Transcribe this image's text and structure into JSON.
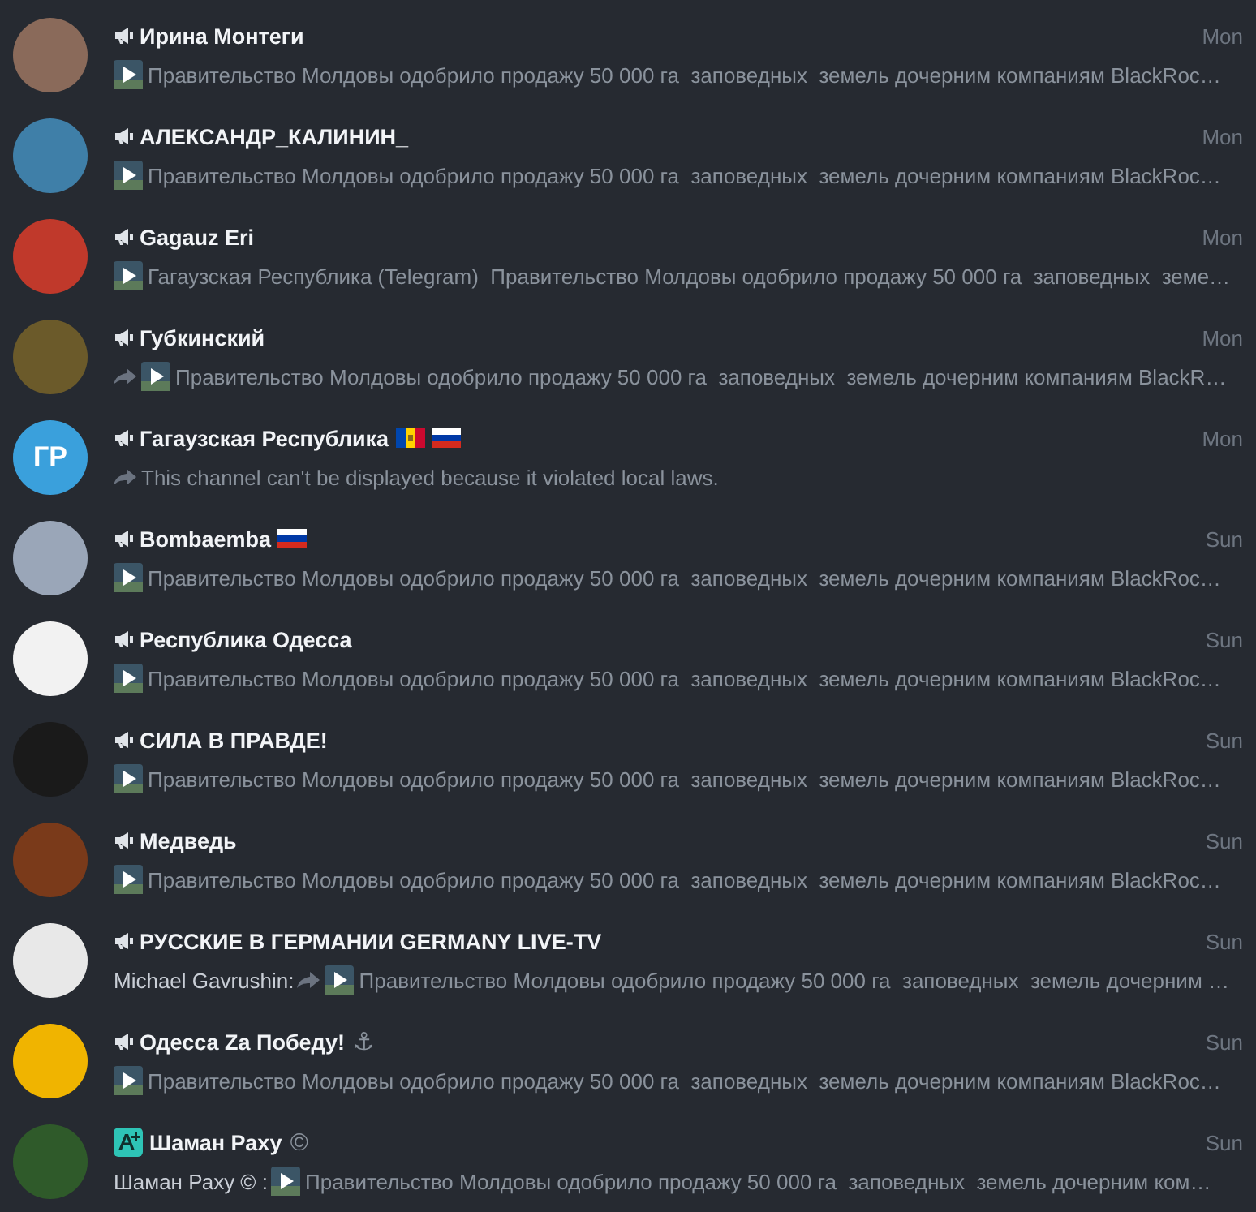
{
  "chats": [
    {
      "kind": "channel",
      "name": "Ирина Монтеги",
      "date": "Mon",
      "avatar": {
        "kind": "photo",
        "color": "#8a6a5a"
      },
      "forwarded": false,
      "video": true,
      "preview": "Правительство Молдовы одобрило продажу 50 000 га  заповедных  земель дочерним компаниям BlackRoc…"
    },
    {
      "kind": "channel",
      "name": "АЛЕКСАНДР_КАЛИНИН_",
      "date": "Mon",
      "avatar": {
        "kind": "photo",
        "color": "#3f7fa8"
      },
      "forwarded": false,
      "video": true,
      "preview": "Правительство Молдовы одобрило продажу 50 000 га  заповедных  земель дочерним компаниям BlackRoc…"
    },
    {
      "kind": "channel",
      "name": "Gagauz Eri",
      "date": "Mon",
      "avatar": {
        "kind": "photo",
        "color": "#c0392b"
      },
      "forwarded": false,
      "video": true,
      "preview": "Гагаузская Республика (Telegram)  Правительство Молдовы одобрило продажу 50 000 га  заповедных  земе…"
    },
    {
      "kind": "channel",
      "name": "Губкинский",
      "date": "Mon",
      "avatar": {
        "kind": "photo",
        "color": "#6b5a2a"
      },
      "forwarded": true,
      "video": true,
      "preview": "Правительство Молдовы одобрило продажу 50 000 га  заповедных  земель дочерним компаниям BlackR…"
    },
    {
      "kind": "channel",
      "name": "Гагаузская Республика",
      "flags": [
        {
          "kind": "moldova"
        },
        {
          "kind": "russia"
        }
      ],
      "date": "Mon",
      "avatar": {
        "kind": "initials",
        "text": "ГР",
        "color": "#3aa0dc"
      },
      "forwarded": true,
      "video": false,
      "preview": "This channel can't be displayed because it violated local laws."
    },
    {
      "kind": "channel",
      "name": "Bombaemba",
      "flags": [
        {
          "kind": "russia"
        }
      ],
      "date": "Sun",
      "avatar": {
        "kind": "photo",
        "color": "#9aa6b8"
      },
      "forwarded": false,
      "video": true,
      "preview": "Правительство Молдовы одобрило продажу 50 000 га  заповедных  земель дочерним компаниям BlackRoc…"
    },
    {
      "kind": "channel",
      "name": "Республика Одесса",
      "date": "Sun",
      "avatar": {
        "kind": "photo",
        "color": "#f2f2f2"
      },
      "forwarded": false,
      "video": true,
      "preview": "Правительство Молдовы одобрило продажу 50 000 га  заповедных  земель дочерним компаниям BlackRoc…"
    },
    {
      "kind": "channel",
      "name": "СИЛА В ПРАВДЕ!",
      "date": "Sun",
      "avatar": {
        "kind": "photo",
        "color": "#1a1a1a"
      },
      "forwarded": false,
      "video": true,
      "preview": "Правительство Молдовы одобрило продажу 50 000 га  заповедных  земель дочерним компаниям BlackRoc…"
    },
    {
      "kind": "channel",
      "name": "Медведь",
      "date": "Sun",
      "avatar": {
        "kind": "photo",
        "color": "#7a3a1a"
      },
      "forwarded": false,
      "video": true,
      "preview": "Правительство Молдовы одобрило продажу 50 000 га  заповедных  земель дочерним компаниям BlackRoc…"
    },
    {
      "kind": "channel",
      "name": "РУССКИЕ В ГЕРМАНИИ GERMANY LIVE-TV",
      "date": "Sun",
      "avatar": {
        "kind": "photo",
        "color": "#e8e8e8"
      },
      "sender": "Michael Gavrushin:",
      "forwarded": true,
      "video": true,
      "preview": "Правительство Молдовы одобрило продажу 50 000 га  заповедных  земель дочерним …"
    },
    {
      "kind": "channel",
      "name": "Одесса Za Победу!",
      "name_suffix": "⚓",
      "date": "Sun",
      "avatar": {
        "kind": "photo",
        "color": "#f0b400"
      },
      "forwarded": false,
      "video": true,
      "preview": "Правительство Молдовы одобрило продажу 50 000 га  заповедных  земель дочерним компаниям BlackRoc…"
    },
    {
      "kind": "app",
      "name": "Шаман Раху",
      "name_suffix": "©",
      "date": "Sun",
      "avatar": {
        "kind": "photo",
        "color": "#2f5a2a"
      },
      "sender": "Шаман Раху © :",
      "forwarded": false,
      "video": true,
      "preview": "Правительство Молдовы одобрило продажу 50 000 га  заповедных  земель дочерним ком…"
    }
  ]
}
